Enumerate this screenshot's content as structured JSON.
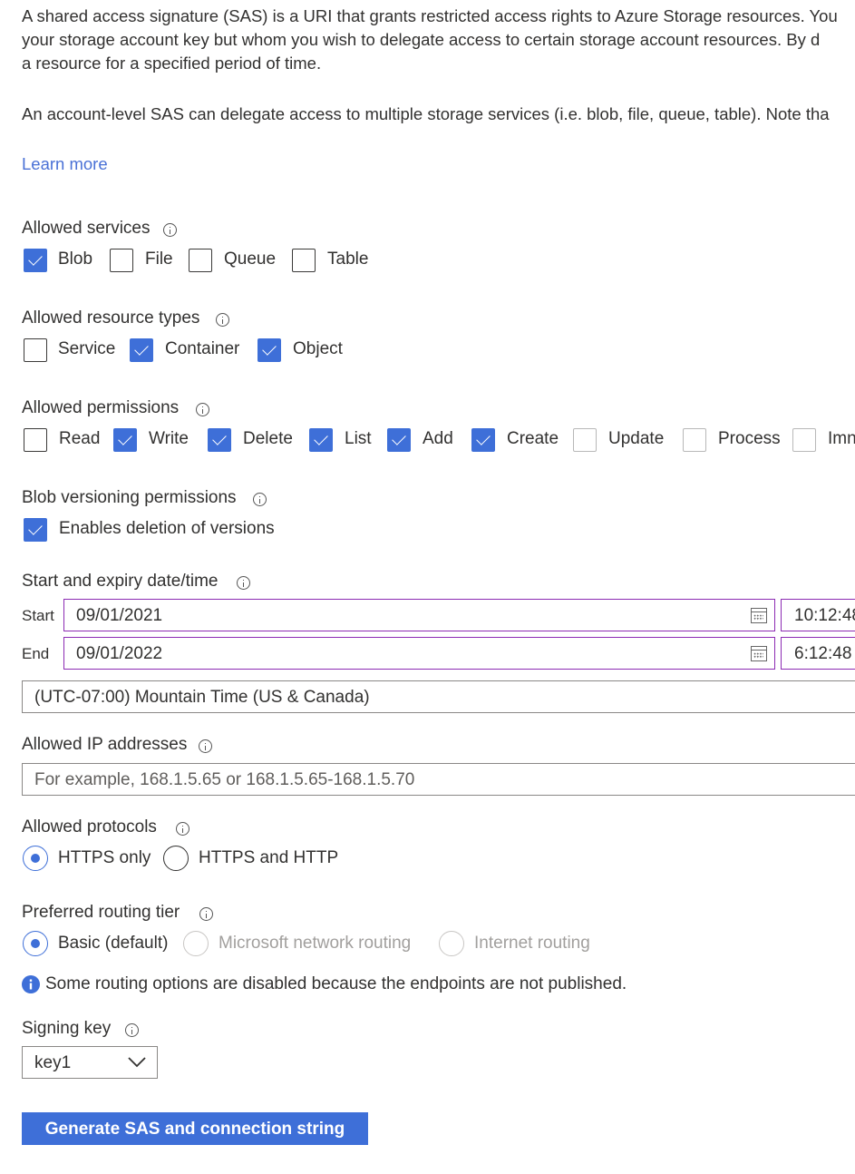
{
  "intro": {
    "line1": "A shared access signature (SAS) is a URI that grants restricted access rights to Azure Storage resources. You",
    "line2": "your storage account key but whom you wish to delegate access to certain storage account resources. By d",
    "line3": "a resource for a specified period of time.",
    "line4": "An account-level SAS can delegate access to multiple storage services (i.e. blob, file, queue, table). Note tha",
    "learn_more": "Learn more"
  },
  "allowed_services": {
    "label": "Allowed services",
    "options": [
      {
        "label": "Blob",
        "checked": true
      },
      {
        "label": "File",
        "checked": false
      },
      {
        "label": "Queue",
        "checked": false
      },
      {
        "label": "Table",
        "checked": false
      }
    ]
  },
  "allowed_resource_types": {
    "label": "Allowed resource types",
    "options": [
      {
        "label": "Service",
        "checked": false
      },
      {
        "label": "Container",
        "checked": true
      },
      {
        "label": "Object",
        "checked": true
      }
    ]
  },
  "allowed_permissions": {
    "label": "Allowed permissions",
    "options": [
      {
        "label": "Read",
        "checked": false
      },
      {
        "label": "Write",
        "checked": true
      },
      {
        "label": "Delete",
        "checked": true
      },
      {
        "label": "List",
        "checked": true
      },
      {
        "label": "Add",
        "checked": true
      },
      {
        "label": "Create",
        "checked": true
      },
      {
        "label": "Update",
        "checked": false
      },
      {
        "label": "Process",
        "checked": false
      },
      {
        "label": "Imn",
        "checked": false
      }
    ]
  },
  "blob_versioning": {
    "label": "Blob versioning permissions",
    "option": {
      "label": "Enables deletion of versions",
      "checked": true
    }
  },
  "datetime": {
    "label": "Start and expiry date/time",
    "start_label": "Start",
    "start_date": "09/01/2021",
    "start_time": "10:12:48",
    "end_label": "End",
    "end_date": "09/01/2022",
    "end_time": "6:12:48",
    "timezone": "(UTC-07:00) Mountain Time (US & Canada)"
  },
  "allowed_ip": {
    "label": "Allowed IP addresses",
    "value": "",
    "placeholder": "For example, 168.1.5.65 or 168.1.5.65-168.1.5.70"
  },
  "allowed_protocols": {
    "label": "Allowed protocols",
    "options": [
      {
        "label": "HTTPS only",
        "selected": true
      },
      {
        "label": "HTTPS and HTTP",
        "selected": false
      }
    ]
  },
  "routing_tier": {
    "label": "Preferred routing tier",
    "options": [
      {
        "label": "Basic (default)",
        "selected": true,
        "disabled": false
      },
      {
        "label": "Microsoft network routing",
        "selected": false,
        "disabled": true
      },
      {
        "label": "Internet routing",
        "selected": false,
        "disabled": true
      }
    ],
    "note": "Some routing options are disabled because the endpoints are not published."
  },
  "signing_key": {
    "label": "Signing key",
    "selected": "key1"
  },
  "generate_button": "Generate SAS and connection string",
  "colors": {
    "accent": "#3e6fd8",
    "link": "#4a71d6",
    "focused_border": "#8c2bb3"
  },
  "icons": [
    "info-icon",
    "calendar-icon",
    "chevron-down-icon",
    "info-filled-icon",
    "checkmark-icon"
  ]
}
